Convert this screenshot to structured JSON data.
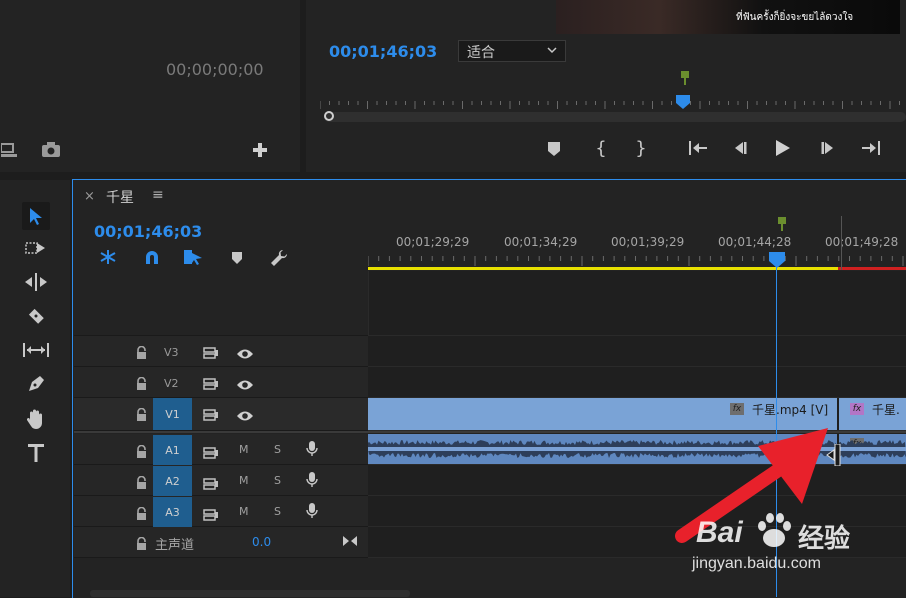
{
  "source_monitor": {
    "timecode": "00;00;00;00"
  },
  "program_monitor": {
    "timecode": "00;01;46;03",
    "zoom_select": "适合",
    "video_subtitle": "ที่ฟันครั้งก็ยิ่งจะขยไล้ดวงใจ"
  },
  "timeline": {
    "close_glyph": "×",
    "sequence_name": "千星",
    "menu_glyph": "≡",
    "timecode": "00;01;46;03",
    "ruler_labels": [
      "00;01;29;29",
      "00;01;34;29",
      "00;01;39;29",
      "00;01;44;28",
      "00;01;49;28"
    ],
    "tracks": {
      "v3": "V3",
      "v2": "V2",
      "v1": "V1",
      "a1": "A1",
      "a2": "A2",
      "a3": "A3"
    },
    "mute": "M",
    "solo": "S",
    "master_label": "主声道",
    "master_value": "0.0",
    "clip_v1_name": "千星.mp4 [V]",
    "clip_v1_next": "千星.",
    "fx_label": "fx"
  },
  "watermark": {
    "logo_text": "Bai",
    "logo_text2": "经验",
    "url": "jingyan.baidu.com"
  },
  "colors": {
    "accent_blue": "#2d8ceb",
    "target_blue": "#1f5e8f",
    "clip_video": "#7aa3d6",
    "clip_audio": "#5f88c0",
    "workarea_yellow": "#e8e000",
    "render_red": "#d02020",
    "arrow_red": "#e8212b"
  }
}
